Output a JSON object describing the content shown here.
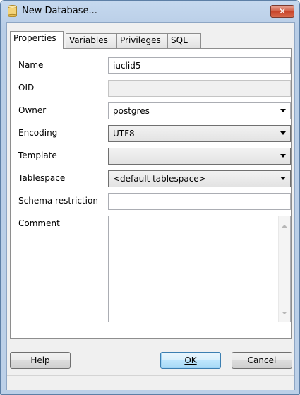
{
  "window": {
    "title": "New Database...",
    "close_symbol": "✕",
    "icon": "database-cylinder-icon"
  },
  "tabs": [
    {
      "label": "Properties",
      "active": true
    },
    {
      "label": "Variables",
      "active": false
    },
    {
      "label": "Privileges",
      "active": false
    },
    {
      "label": "SQL",
      "active": false
    }
  ],
  "form": {
    "name": {
      "label": "Name",
      "value": "iuclid5"
    },
    "oid": {
      "label": "OID",
      "value": ""
    },
    "owner": {
      "label": "Owner",
      "value": "postgres"
    },
    "encoding": {
      "label": "Encoding",
      "value": "UTF8"
    },
    "template": {
      "label": "Template",
      "value": ""
    },
    "tablespace": {
      "label": "Tablespace",
      "value": "<default tablespace>"
    },
    "schema_restriction": {
      "label": "Schema restriction",
      "value": ""
    },
    "comment": {
      "label": "Comment",
      "value": ""
    }
  },
  "buttons": {
    "help": "Help",
    "ok": "OK",
    "cancel": "Cancel"
  },
  "colors": {
    "frame": "#b8cde6",
    "close_button": "#c7442a",
    "default_button": "#bee6fd"
  }
}
